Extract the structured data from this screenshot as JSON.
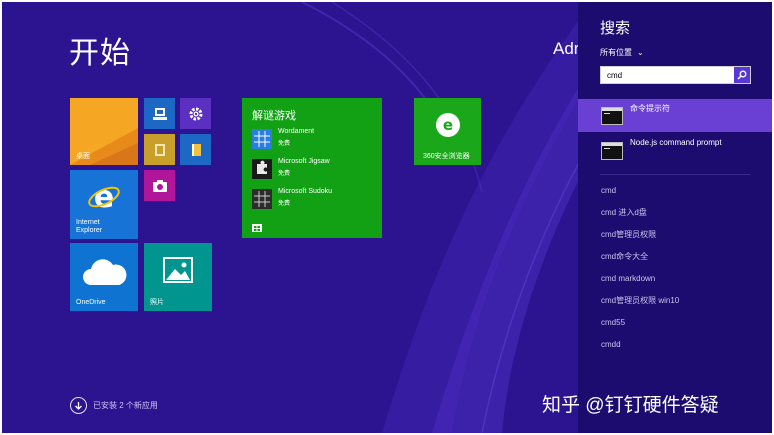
{
  "start": {
    "title": "开始",
    "user": "Adr"
  },
  "tiles": {
    "desktop": "桌面",
    "ie": "Internet Explorer",
    "onedrive": "OneDrive",
    "photos": "照片",
    "browser_360": "360安全浏览器",
    "games": {
      "title": "解谜游戏",
      "items": [
        {
          "name": "Wordament",
          "price": "免费"
        },
        {
          "name": "Microsoft Jigsaw",
          "price": "免费"
        },
        {
          "name": "Microsoft Sudoku",
          "price": "免费"
        }
      ]
    }
  },
  "installed_notice": "已安装 2 个新应用",
  "search_pane": {
    "title": "搜索",
    "scope": "所有位置",
    "query": "cmd",
    "results": [
      {
        "label": "命令提示符",
        "selected": true
      },
      {
        "label": "Node.js command prompt",
        "selected": false
      }
    ],
    "suggestions": [
      "cmd",
      "cmd 进入d盘",
      "cmd管理员权限",
      "cmd命令大全",
      "cmd markdown",
      "cmd管理员权限 win10",
      "cmd55",
      "cmdd"
    ]
  },
  "watermark": "知乎 @钉钉硬件答疑",
  "colors": {
    "background": "#2c1490",
    "charm": "#1c0c70",
    "selected_result": "#6a3fd4",
    "games_tile": "#12a114"
  }
}
